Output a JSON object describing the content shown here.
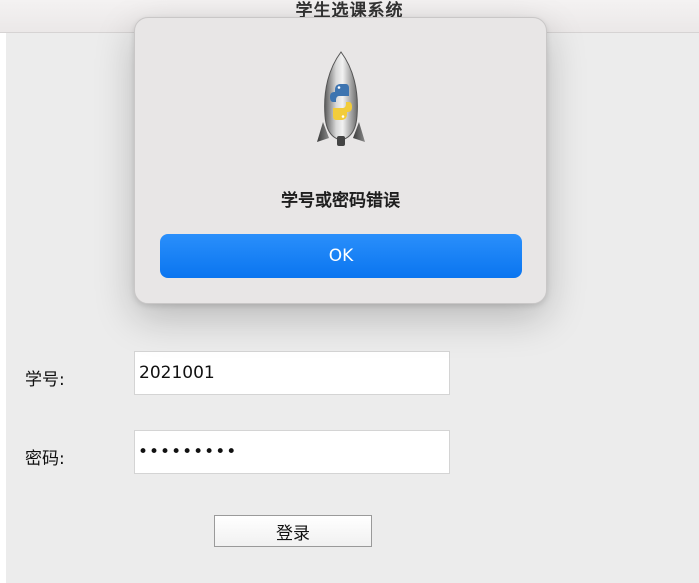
{
  "window": {
    "title": "学生选课系统"
  },
  "form": {
    "student_id_label": "学号:",
    "student_id_value": "2021001",
    "password_label": "密码:",
    "password_masked": "•••••••••",
    "login_button_label": "登录"
  },
  "alert": {
    "icon": "python-launcher-rocket-icon",
    "message": "学号或密码错误",
    "ok_label": "OK"
  },
  "colors": {
    "accent": "#0a7bf5",
    "background": "#ececec"
  }
}
